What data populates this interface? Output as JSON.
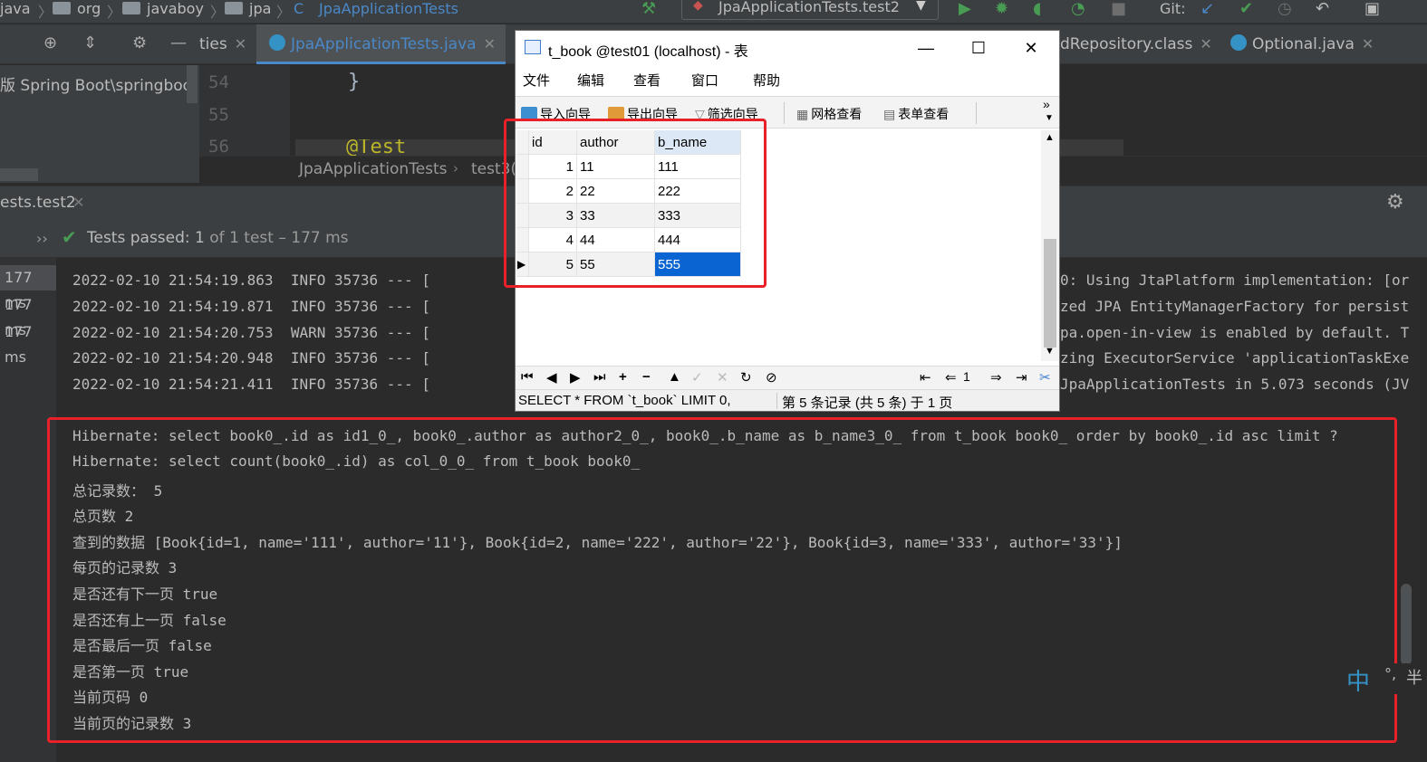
{
  "breadcrumb": {
    "items": [
      "java",
      "org",
      "javaboy",
      "jpa",
      "JpaApplicationTests"
    ],
    "run_config": "JpaApplicationTests.test2",
    "git_label": "Git:"
  },
  "editor_tabs": {
    "tab1": "ties",
    "tab2": "JpaApplicationTests.java",
    "tab3": "dRepository.class",
    "tab4": "Optional.java"
  },
  "project_pane": {
    "path_text": "版 Spring Boot\\springboot-s"
  },
  "editor": {
    "line_numbers": [
      "54",
      "55",
      "56"
    ],
    "code_brace": "}",
    "code_annotation": "@Test",
    "crumb_class": "JpaApplicationTests",
    "crumb_method": "test3("
  },
  "run_panel": {
    "tab_label": "ests.test2",
    "status_prefix": "Tests passed:",
    "status_count": "1",
    "status_suffix": "of 1 test",
    "status_time": "– 177 ms",
    "durations": [
      "177 ms",
      "177 ms",
      "177 ms"
    ]
  },
  "console": {
    "log_lines": [
      {
        "left": "2022-02-10 21:54:19.863  INFO 35736 --- [",
        "right": "0: Using JtaPlatform implementation: [or"
      },
      {
        "left": "2022-02-10 21:54:19.871  INFO 35736 --- [",
        "right": "zed JPA EntityManagerFactory for persist"
      },
      {
        "left": "2022-02-10 21:54:20.753  WARN 35736 --- [",
        "right": "pa.open-in-view is enabled by default. T"
      },
      {
        "left": "2022-02-10 21:54:20.948  INFO 35736 --- [",
        "right": "zing ExecutorService 'applicationTaskExe"
      },
      {
        "left": "2022-02-10 21:54:21.411  INFO 35736 --- [",
        "right": "JpaApplicationTests in 5.073 seconds (JV"
      }
    ],
    "output_lines": [
      "Hibernate: select book0_.id as id1_0_, book0_.author as author2_0_, book0_.b_name as b_name3_0_ from t_book book0_ order by book0_.id asc limit ?",
      "Hibernate: select count(book0_.id) as col_0_0_ from t_book book0_",
      "总记录数： 5",
      "总页数 2",
      "查到的数据 [Book{id=1, name='111', author='11'}, Book{id=2, name='222', author='22'}, Book{id=3, name='333', author='33'}]",
      "每页的记录数 3",
      "是否还有下一页 true",
      "是否还有上一页 false",
      "是否最后一页 false",
      "是否第一页 true",
      "当前页码 0",
      "当前页的记录数 3"
    ]
  },
  "navicat": {
    "title": "t_book @test01 (localhost) - 表",
    "menu": [
      "文件",
      "编辑",
      "查看",
      "窗口",
      "帮助"
    ],
    "toolbar": {
      "import": "导入向导",
      "export": "导出向导",
      "filter": "筛选向导",
      "grid_view": "网格查看",
      "form_view": "表单查看"
    },
    "columns": [
      "id",
      "author",
      "b_name"
    ],
    "rows": [
      {
        "id": "1",
        "author": "11",
        "b_name": "111"
      },
      {
        "id": "2",
        "author": "22",
        "b_name": "222"
      },
      {
        "id": "3",
        "author": "33",
        "b_name": "333"
      },
      {
        "id": "4",
        "author": "44",
        "b_name": "444"
      },
      {
        "id": "5",
        "author": "55",
        "b_name": "555"
      }
    ],
    "page_input": "1",
    "status_sql": "SELECT * FROM `t_book` LIMIT 0,",
    "status_record": "第 5 条记录 (共 5 条) 于 1 页"
  },
  "ime": {
    "label": "中",
    "extra": "°,",
    "half": "半"
  },
  "colors": {
    "accent": "#4a88c7",
    "highlight_red": "#e8202a",
    "selection_blue": "#0a64d2",
    "pass_green": "#499c54"
  }
}
